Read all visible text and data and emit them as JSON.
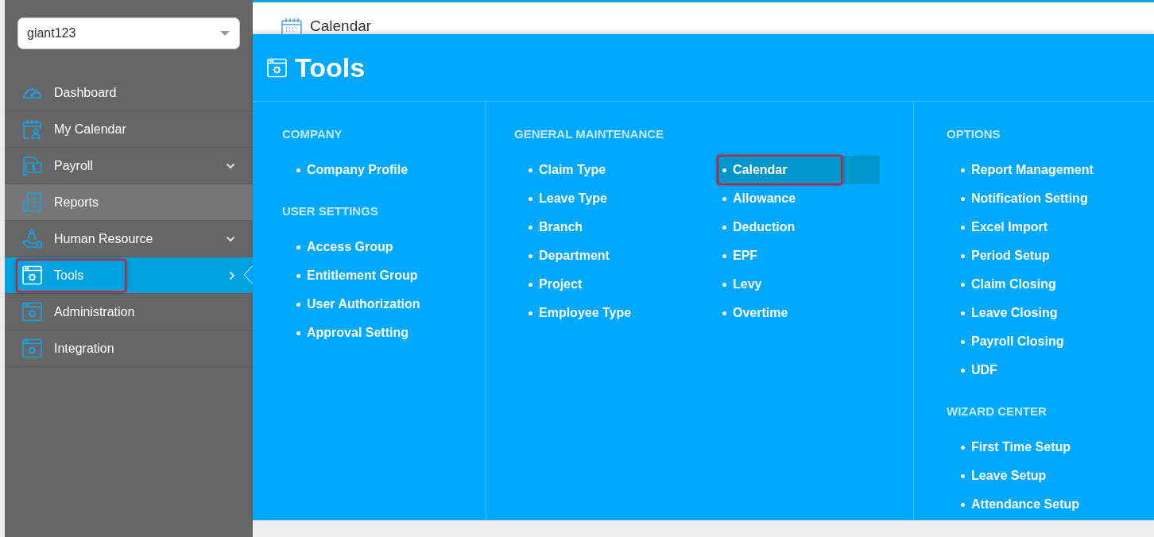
{
  "account_select": {
    "value": "giant123"
  },
  "sidebar": {
    "items": [
      {
        "label": "Dashboard",
        "kind": "plain",
        "selected": false,
        "hovered": false,
        "annotated": false
      },
      {
        "label": "My Calendar",
        "kind": "plain",
        "selected": false,
        "hovered": false,
        "annotated": false
      },
      {
        "label": "Payroll",
        "kind": "expandable",
        "selected": false,
        "hovered": false,
        "annotated": false
      },
      {
        "label": "Reports",
        "kind": "plain",
        "selected": false,
        "hovered": true,
        "annotated": false
      },
      {
        "label": "Human Resource",
        "kind": "expandable",
        "selected": false,
        "hovered": false,
        "annotated": false
      },
      {
        "label": "Tools",
        "kind": "flyout",
        "selected": true,
        "hovered": false,
        "annotated": true
      },
      {
        "label": "Administration",
        "kind": "plain",
        "selected": false,
        "hovered": false,
        "annotated": false
      },
      {
        "label": "Integration",
        "kind": "plain",
        "selected": false,
        "hovered": false,
        "annotated": false
      }
    ]
  },
  "page_header": {
    "title": "Calendar"
  },
  "tools_panel": {
    "title": "Tools",
    "columns": [
      {
        "sections": [
          {
            "heading": "COMPANY",
            "items": [
              {
                "label": "Company Profile",
                "hovered": false,
                "annotated": false
              }
            ]
          },
          {
            "heading": "USER SETTINGS",
            "items": [
              {
                "label": "Access Group",
                "hovered": false,
                "annotated": false
              },
              {
                "label": "Entitlement Group",
                "hovered": false,
                "annotated": false
              },
              {
                "label": "User Authorization",
                "hovered": false,
                "annotated": false
              },
              {
                "label": "Approval Setting",
                "hovered": false,
                "annotated": false
              }
            ]
          }
        ]
      },
      {
        "sections": [
          {
            "heading": "GENERAL MAINTENANCE",
            "kind": "grid",
            "items": [
              {
                "label": "Claim Type",
                "hovered": false,
                "annotated": false
              },
              {
                "label": "Leave Type",
                "hovered": false,
                "annotated": false
              },
              {
                "label": "Branch",
                "hovered": false,
                "annotated": false
              },
              {
                "label": "Department",
                "hovered": false,
                "annotated": false
              },
              {
                "label": "Project",
                "hovered": false,
                "annotated": false
              },
              {
                "label": "Employee Type",
                "hovered": false,
                "annotated": false
              },
              {
                "label": "Calendar",
                "hovered": true,
                "annotated": true
              },
              {
                "label": "Allowance",
                "hovered": false,
                "annotated": false
              },
              {
                "label": "Deduction",
                "hovered": false,
                "annotated": false
              },
              {
                "label": "EPF",
                "hovered": false,
                "annotated": false
              },
              {
                "label": "Levy",
                "hovered": false,
                "annotated": false
              },
              {
                "label": "Overtime",
                "hovered": false,
                "annotated": false
              }
            ]
          }
        ]
      },
      {
        "sections": [
          {
            "heading": "OPTIONS",
            "items": [
              {
                "label": "Report Management",
                "hovered": false,
                "annotated": false
              },
              {
                "label": "Notification Setting",
                "hovered": false,
                "annotated": false
              },
              {
                "label": "Excel Import",
                "hovered": false,
                "annotated": false
              },
              {
                "label": "Period Setup",
                "hovered": false,
                "annotated": false
              },
              {
                "label": "Claim Closing",
                "hovered": false,
                "annotated": false
              },
              {
                "label": "Leave Closing",
                "hovered": false,
                "annotated": false
              },
              {
                "label": "Payroll Closing",
                "hovered": false,
                "annotated": false
              },
              {
                "label": "UDF",
                "hovered": false,
                "annotated": false
              }
            ]
          },
          {
            "heading": "WIZARD CENTER",
            "items": [
              {
                "label": "First Time Setup",
                "hovered": false,
                "annotated": false
              },
              {
                "label": "Leave Setup",
                "hovered": false,
                "annotated": false
              },
              {
                "label": "Attendance Setup",
                "hovered": false,
                "annotated": false
              }
            ]
          }
        ]
      }
    ]
  }
}
